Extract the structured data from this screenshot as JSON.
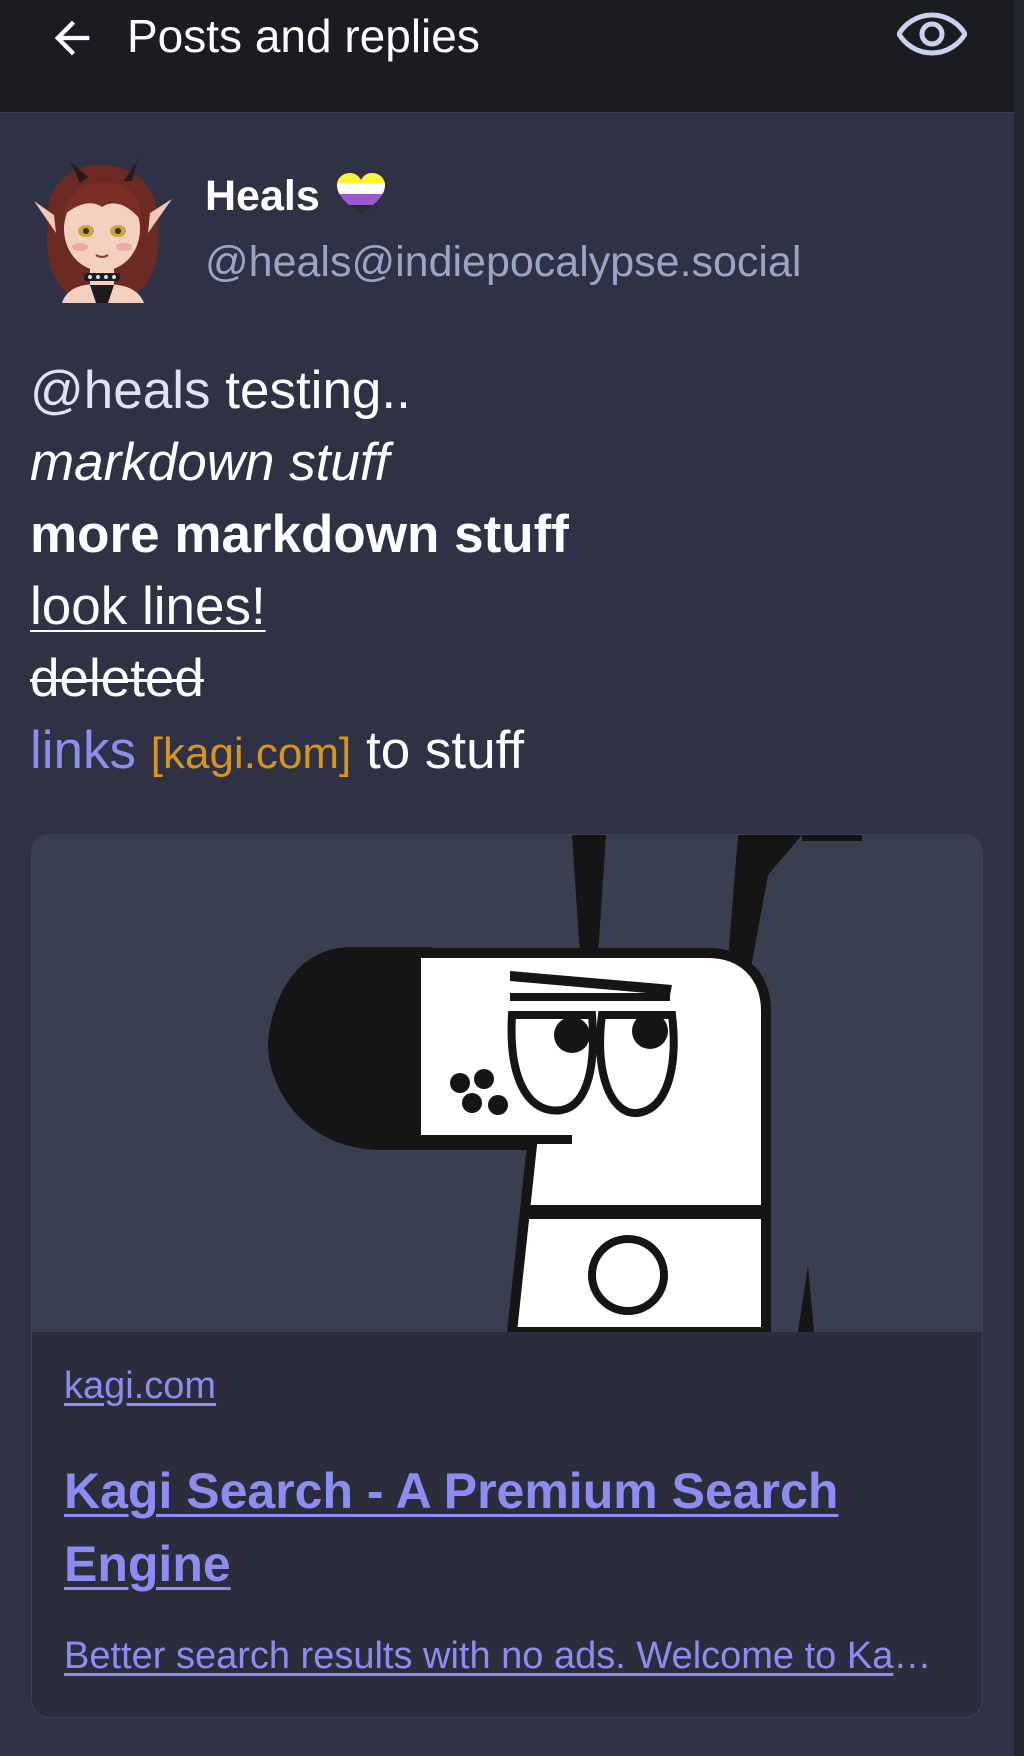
{
  "header": {
    "title": "Posts and replies",
    "back_icon": "arrow-left-icon",
    "view_icon": "eye-icon"
  },
  "post": {
    "author": {
      "display_name": "Heals",
      "handle": "@heals@indiepocalypse.social",
      "badge_icon": "nonbinary-heart-icon"
    },
    "content": {
      "mention": "@heals",
      "line1_rest": " testing..",
      "line2_italic": "markdown stuff",
      "line3_bold": "more markdown stuff",
      "line4_underline": "look lines!",
      "line5_strike": "deleted",
      "line6_link": "links",
      "line6_domain": "[kagi.com]",
      "line6_rest": " to stuff"
    },
    "link_card": {
      "domain": "kagi.com",
      "title": "Kagi Search - A Premium Search Engine",
      "description": "Better search results with no ads. Welcome to Kagi (pronounced kah-gee), a search engine that respects your privacy."
    }
  },
  "colors": {
    "background": "#2f3244",
    "topbar": "#1b1c22",
    "link": "#8c8cf2",
    "domain_tag": "#d8951a",
    "handle": "#9aa4c4"
  }
}
